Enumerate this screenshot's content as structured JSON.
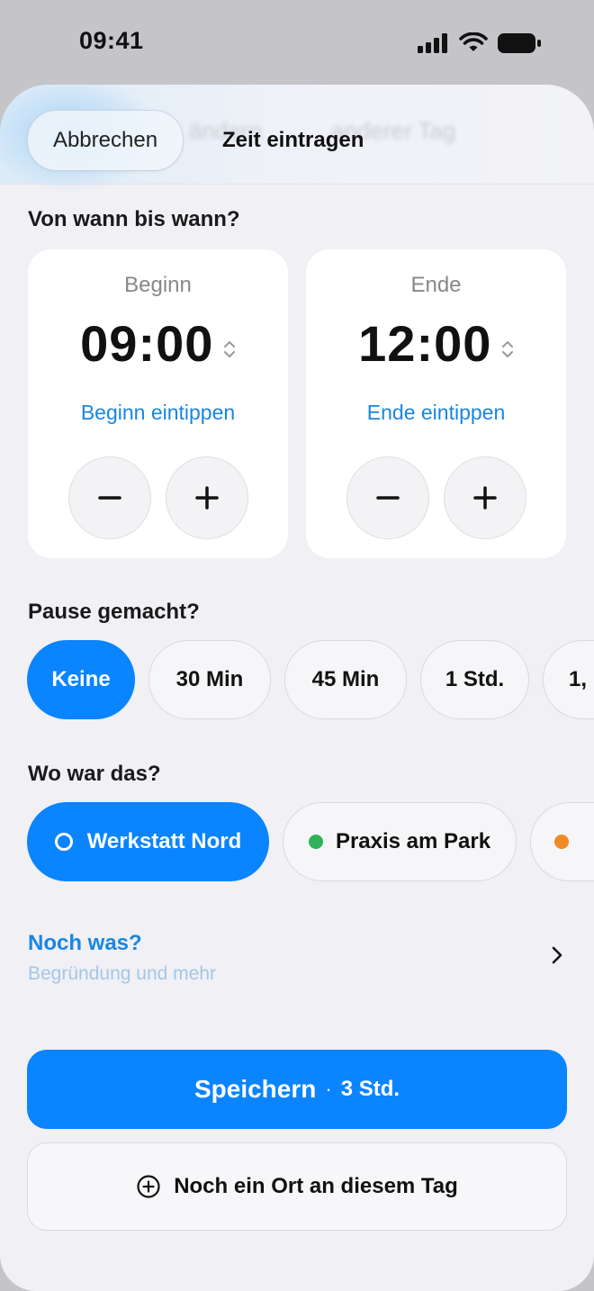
{
  "status_bar": {
    "time": "09:41",
    "icons": [
      "cellular-signal-icon",
      "wifi-icon",
      "battery-icon"
    ]
  },
  "header": {
    "cancel_label": "Abbrechen",
    "title": "Zeit eintragen",
    "ghost_labels": [
      "ändern",
      "anderer Tag"
    ]
  },
  "time_section": {
    "label": "Von wann bis wann?",
    "start": {
      "title": "Beginn",
      "time": "09:00",
      "link": "Beginn eintippen"
    },
    "end": {
      "title": "Ende",
      "time": "12:00",
      "link": "Ende eintippen"
    }
  },
  "pause_section": {
    "label": "Pause gemacht?",
    "options": [
      "Keine",
      "30 Min",
      "45 Min",
      "1 Std.",
      "1,"
    ],
    "selected": "Keine"
  },
  "location_section": {
    "label": "Wo war das?",
    "options": [
      {
        "label": "Werkstatt Nord",
        "color": "#ffffff"
      },
      {
        "label": "Praxis am Park",
        "color": "#2fb35a"
      },
      {
        "label": "",
        "color": "#f08a24"
      }
    ],
    "selected": "Werkstatt Nord"
  },
  "more": {
    "title": "Noch was?",
    "subtitle": "Begründung und mehr"
  },
  "save": {
    "label": "Speichern",
    "separator": "·",
    "hours": "3 Std."
  },
  "another": {
    "label": "Noch ein Ort an diesem Tag"
  },
  "colors": {
    "accent": "#0a84ff",
    "link": "#1a86e0",
    "background": "#f0f0f5"
  }
}
